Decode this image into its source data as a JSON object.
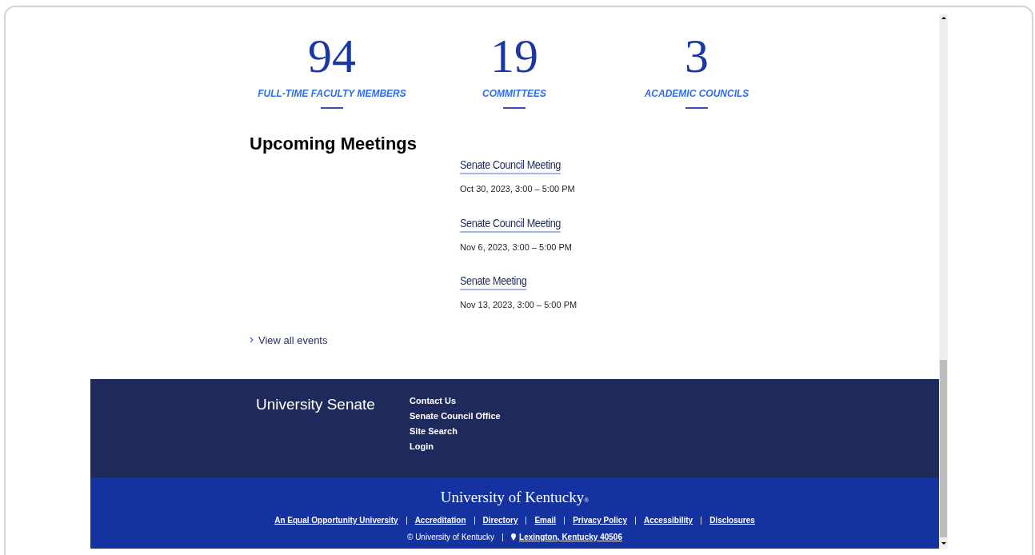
{
  "stats": [
    {
      "number": "94",
      "label": "FULL-TIME FACULTY MEMBERS"
    },
    {
      "number": "19",
      "label": "COMMITTEES"
    },
    {
      "number": "3",
      "label": "ACADEMIC COUNCILS"
    }
  ],
  "meetings": {
    "heading": "Upcoming Meetings",
    "events": [
      {
        "title": "Senate Council Meeting",
        "when": "Oct 30, 2023, 3:00 – 5:00 PM"
      },
      {
        "title": "Senate Council Meeting",
        "when": "Nov 6, 2023, 3:00 – 5:00 PM"
      },
      {
        "title": "Senate Meeting",
        "when": "Nov 13, 2023, 3:00 – 5:00 PM"
      }
    ],
    "view_all": "View all events"
  },
  "footer": {
    "title": "University Senate",
    "links": [
      "Contact Us",
      "Senate Council Office",
      "Site Search",
      "Login"
    ]
  },
  "bottom": {
    "wordmark": "University of Kentucky",
    "wordmark_mark": "®",
    "links": [
      "An Equal Opportunity University",
      "Accreditation",
      "Directory",
      "Email",
      "Privacy Policy",
      "Accessibility",
      "Disclosures"
    ],
    "copyright": "© University of Kentucky",
    "address": "Lexington, Kentucky 40506"
  }
}
